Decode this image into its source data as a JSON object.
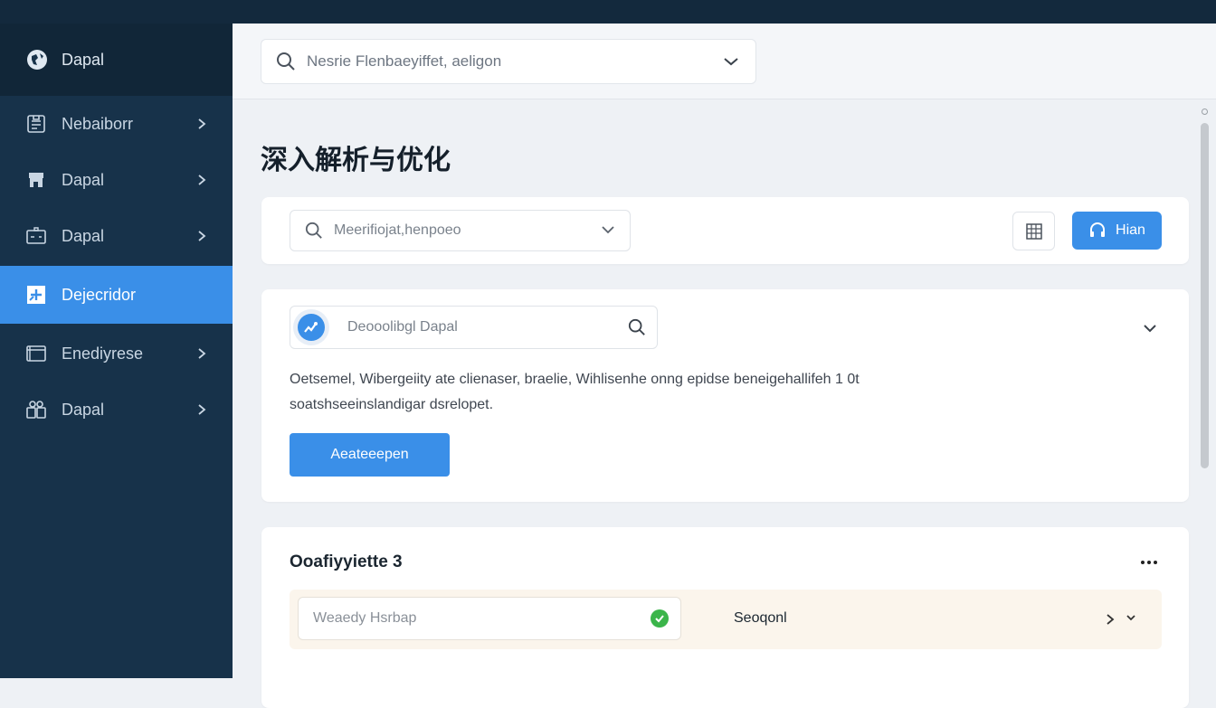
{
  "sidebar": {
    "brand": "Dapal",
    "items": [
      {
        "label": "Nebaiborr",
        "icon": "document-icon"
      },
      {
        "label": "Dapal",
        "icon": "store-icon"
      },
      {
        "label": "Dapal",
        "icon": "terminal-icon"
      },
      {
        "label": "Dejecridor",
        "icon": "add-box-icon",
        "active": true
      },
      {
        "label": "Enediyrese",
        "icon": "window-icon"
      },
      {
        "label": "Dapal",
        "icon": "users-icon"
      }
    ]
  },
  "header": {
    "search_value": "Nesrie Flenbaeyiffet, aeligon"
  },
  "page": {
    "title": "深入解析与优化"
  },
  "filter": {
    "select_value": "Meerifiojat,henpoeo",
    "primary_label": "Hian"
  },
  "detail": {
    "search_value": "Deooolibgl Dapal",
    "description_line1": "Oetsemel, Wibergeiity ate clienaser, braelie, Wihlisenhe onng epidse beneigehallifeh 1 0t",
    "description_line2": "soatshseeinslandigar dsrelopet.",
    "action_label": "Aeateeepen"
  },
  "list": {
    "title": "Ooafiyyiette 3",
    "row": {
      "input_value": "Weaedy Hsrbap",
      "label": "Seoqonl"
    }
  },
  "colors": {
    "sidebar": "#17324a",
    "accent": "#3a8fe8",
    "success": "#3bb54a"
  }
}
